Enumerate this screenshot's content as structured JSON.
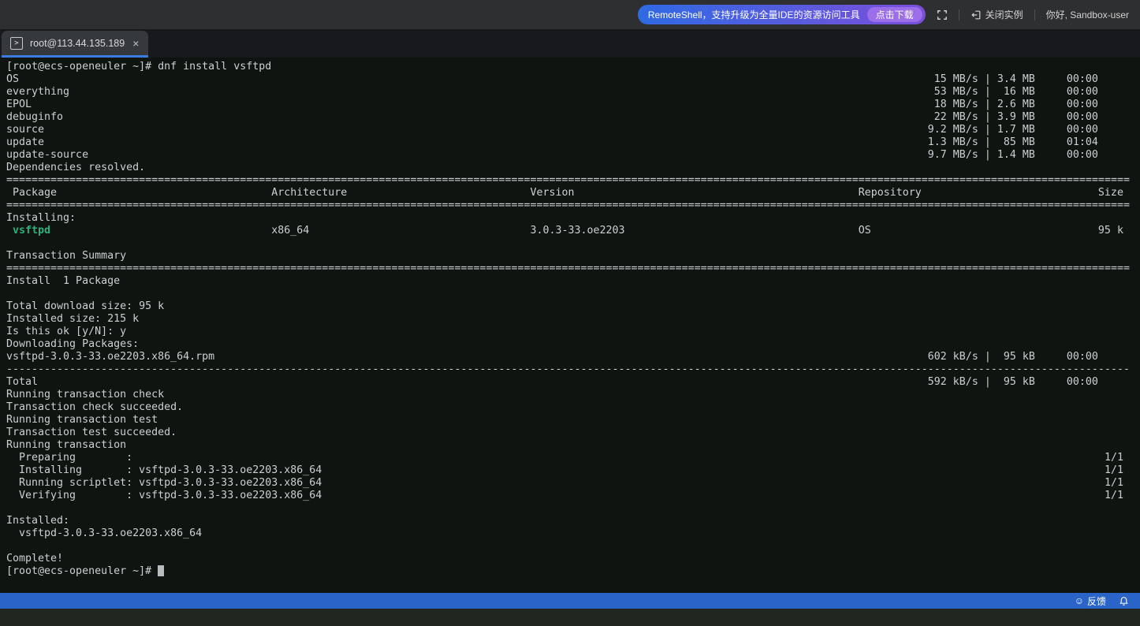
{
  "colors": {
    "topbar_bg": "#2e2f31",
    "tabstrip_bg": "#17191d",
    "tab_bg": "#35383c",
    "tab_underline": "#3b7ce0",
    "terminal_bg": "#0f1411",
    "terminal_fg": "#ccd0d2",
    "ansi_green": "#2ab27c",
    "statusbar_bg": "#2a64c9",
    "bottom_bg": "#222621",
    "banner_from": "#2f6ae3",
    "banner_to": "#7b4ed9",
    "download_pill": "#9c6ee9"
  },
  "header": {
    "banner_text": "RemoteShell，支持升级为全量IDE的资源访问工具",
    "download_label": "点击下载",
    "close_instance_label": "关闭实例",
    "greeting": "你好, Sandbox-user"
  },
  "tab": {
    "title": "root@113.44.135.189",
    "terminal_glyph": ">",
    "close_glyph": "×"
  },
  "statusbar": {
    "smiley_glyph": "☺",
    "feedback_label": "反馈"
  },
  "terminal": {
    "lines": [
      {
        "segs": [
          {
            "c": 0,
            "t": "[root@ecs-openeuler ~]# dnf install vsftpd"
          }
        ]
      },
      {
        "segs": [
          {
            "c": 0,
            "t": "OS"
          },
          {
            "c": 146,
            "t": " 15 MB/s | 3.4 MB     00:00"
          }
        ]
      },
      {
        "segs": [
          {
            "c": 0,
            "t": "everything"
          },
          {
            "c": 146,
            "t": " 53 MB/s |  16 MB     00:00"
          }
        ]
      },
      {
        "segs": [
          {
            "c": 0,
            "t": "EPOL"
          },
          {
            "c": 146,
            "t": " 18 MB/s | 2.6 MB     00:00"
          }
        ]
      },
      {
        "segs": [
          {
            "c": 0,
            "t": "debuginfo"
          },
          {
            "c": 146,
            "t": " 22 MB/s | 3.9 MB     00:00"
          }
        ]
      },
      {
        "segs": [
          {
            "c": 0,
            "t": "source"
          },
          {
            "c": 146,
            "t": "9.2 MB/s | 1.7 MB     00:00"
          }
        ]
      },
      {
        "segs": [
          {
            "c": 0,
            "t": "update"
          },
          {
            "c": 146,
            "t": "1.3 MB/s |  85 MB     01:04"
          }
        ]
      },
      {
        "segs": [
          {
            "c": 0,
            "t": "update-source"
          },
          {
            "c": 146,
            "t": "9.7 MB/s | 1.4 MB     00:00"
          }
        ]
      },
      {
        "segs": [
          {
            "c": 0,
            "t": "Dependencies resolved."
          }
        ]
      },
      {
        "segs": [
          {
            "c": 0,
            "r": "=",
            "n": 178
          }
        ]
      },
      {
        "segs": [
          {
            "c": 1,
            "t": "Package"
          },
          {
            "c": 42,
            "t": "Architecture"
          },
          {
            "c": 83,
            "t": "Version"
          },
          {
            "c": 135,
            "t": "Repository"
          },
          {
            "c": 173,
            "t": "Size"
          }
        ]
      },
      {
        "segs": [
          {
            "c": 0,
            "r": "=",
            "n": 178
          }
        ]
      },
      {
        "segs": [
          {
            "c": 0,
            "t": "Installing:"
          }
        ]
      },
      {
        "segs": [
          {
            "c": 1,
            "t": "vsftpd",
            "s": "g"
          },
          {
            "c": 42,
            "t": "x86_64"
          },
          {
            "c": 83,
            "t": "3.0.3-33.oe2203"
          },
          {
            "c": 135,
            "t": "OS"
          },
          {
            "c": 173,
            "t": "95 k"
          }
        ]
      },
      {
        "segs": []
      },
      {
        "segs": [
          {
            "c": 0,
            "t": "Transaction Summary"
          }
        ]
      },
      {
        "segs": [
          {
            "c": 0,
            "r": "=",
            "n": 178
          }
        ]
      },
      {
        "segs": [
          {
            "c": 0,
            "t": "Install  1 Package"
          }
        ]
      },
      {
        "segs": []
      },
      {
        "segs": [
          {
            "c": 0,
            "t": "Total download size: 95 k"
          }
        ]
      },
      {
        "segs": [
          {
            "c": 0,
            "t": "Installed size: 215 k"
          }
        ]
      },
      {
        "segs": [
          {
            "c": 0,
            "t": "Is this ok [y/N]: y"
          }
        ]
      },
      {
        "segs": [
          {
            "c": 0,
            "t": "Downloading Packages:"
          }
        ]
      },
      {
        "segs": [
          {
            "c": 0,
            "t": "vsftpd-3.0.3-33.oe2203.x86_64.rpm"
          },
          {
            "c": 146,
            "t": "602 kB/s |  95 kB     00:00"
          }
        ]
      },
      {
        "segs": [
          {
            "c": 0,
            "r": "-",
            "n": 178
          }
        ]
      },
      {
        "segs": [
          {
            "c": 0,
            "t": "Total"
          },
          {
            "c": 146,
            "t": "592 kB/s |  95 kB     00:00"
          }
        ]
      },
      {
        "segs": [
          {
            "c": 0,
            "t": "Running transaction check"
          }
        ]
      },
      {
        "segs": [
          {
            "c": 0,
            "t": "Transaction check succeeded."
          }
        ]
      },
      {
        "segs": [
          {
            "c": 0,
            "t": "Running transaction test"
          }
        ]
      },
      {
        "segs": [
          {
            "c": 0,
            "t": "Transaction test succeeded."
          }
        ]
      },
      {
        "segs": [
          {
            "c": 0,
            "t": "Running transaction"
          }
        ]
      },
      {
        "segs": [
          {
            "c": 0,
            "t": "  Preparing        :"
          },
          {
            "c": 174,
            "t": "1/1"
          }
        ]
      },
      {
        "segs": [
          {
            "c": 0,
            "t": "  Installing       : vsftpd-3.0.3-33.oe2203.x86_64"
          },
          {
            "c": 174,
            "t": "1/1"
          }
        ]
      },
      {
        "segs": [
          {
            "c": 0,
            "t": "  Running scriptlet: vsftpd-3.0.3-33.oe2203.x86_64"
          },
          {
            "c": 174,
            "t": "1/1"
          }
        ]
      },
      {
        "segs": [
          {
            "c": 0,
            "t": "  Verifying        : vsftpd-3.0.3-33.oe2203.x86_64"
          },
          {
            "c": 174,
            "t": "1/1"
          }
        ]
      },
      {
        "segs": []
      },
      {
        "segs": [
          {
            "c": 0,
            "t": "Installed:"
          }
        ]
      },
      {
        "segs": [
          {
            "c": 0,
            "t": "  vsftpd-3.0.3-33.oe2203.x86_64"
          }
        ]
      },
      {
        "segs": []
      },
      {
        "segs": [
          {
            "c": 0,
            "t": "Complete!"
          }
        ]
      },
      {
        "segs": [
          {
            "c": 0,
            "t": "[root@ecs-openeuler ~]# "
          }
        ],
        "cursor": true,
        "cursorCol": 24
      }
    ]
  }
}
